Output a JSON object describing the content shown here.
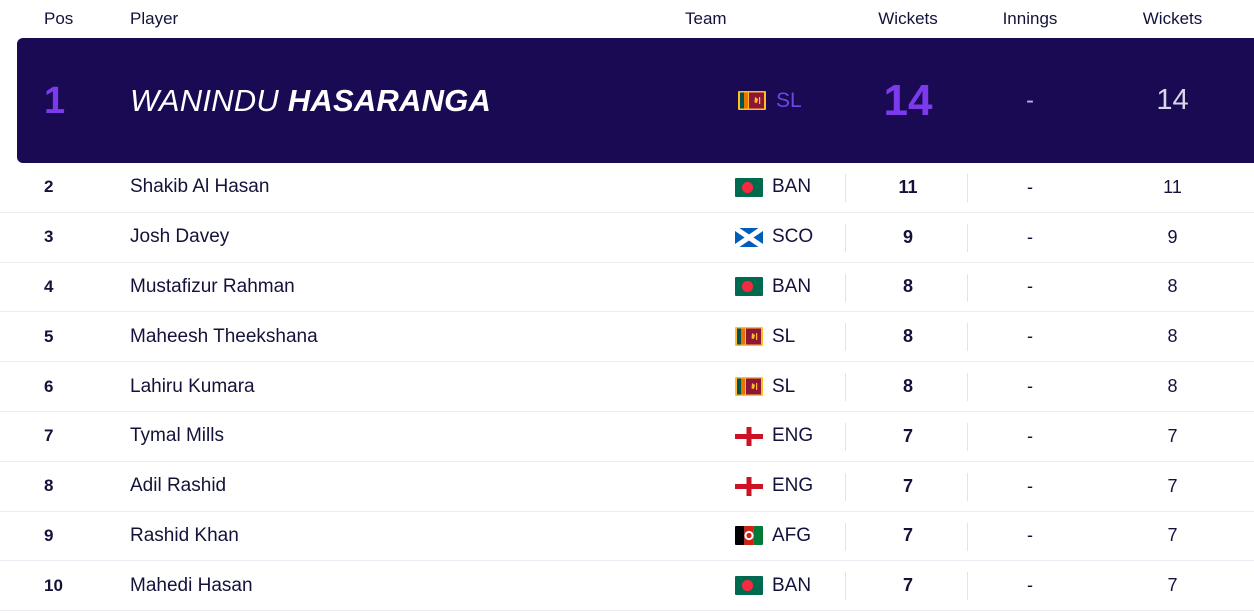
{
  "table": {
    "headers": {
      "pos": "Pos",
      "player": "Player",
      "team": "Team",
      "wickets": "Wickets",
      "innings": "Innings",
      "wickets2": "Wickets"
    },
    "highlighted": {
      "pos": "1",
      "player_first": "WANINDU",
      "player_last": "HASARANGA",
      "team_code": "SL",
      "team_flag": "sri-lanka-flag-icon",
      "wickets": "14",
      "innings": "-",
      "wickets2": "14"
    },
    "rows": [
      {
        "pos": "2",
        "player": "Shakib Al Hasan",
        "team_code": "BAN",
        "team_flag": "bangladesh-flag-icon",
        "wickets": "11",
        "innings": "-",
        "wickets2": "11"
      },
      {
        "pos": "3",
        "player": "Josh Davey",
        "team_code": "SCO",
        "team_flag": "scotland-flag-icon",
        "wickets": "9",
        "innings": "-",
        "wickets2": "9"
      },
      {
        "pos": "4",
        "player": "Mustafizur Rahman",
        "team_code": "BAN",
        "team_flag": "bangladesh-flag-icon",
        "wickets": "8",
        "innings": "-",
        "wickets2": "8"
      },
      {
        "pos": "5",
        "player": "Maheesh Theekshana",
        "team_code": "SL",
        "team_flag": "sri-lanka-flag-icon",
        "wickets": "8",
        "innings": "-",
        "wickets2": "8"
      },
      {
        "pos": "6",
        "player": "Lahiru Kumara",
        "team_code": "SL",
        "team_flag": "sri-lanka-flag-icon",
        "wickets": "8",
        "innings": "-",
        "wickets2": "8"
      },
      {
        "pos": "7",
        "player": "Tymal Mills",
        "team_code": "ENG",
        "team_flag": "england-flag-icon",
        "wickets": "7",
        "innings": "-",
        "wickets2": "7"
      },
      {
        "pos": "8",
        "player": "Adil Rashid",
        "team_code": "ENG",
        "team_flag": "england-flag-icon",
        "wickets": "7",
        "innings": "-",
        "wickets2": "7"
      },
      {
        "pos": "9",
        "player": "Rashid Khan",
        "team_code": "AFG",
        "team_flag": "afghanistan-flag-icon",
        "wickets": "7",
        "innings": "-",
        "wickets2": "7"
      },
      {
        "pos": "10",
        "player": "Mahedi Hasan",
        "team_code": "BAN",
        "team_flag": "bangladesh-flag-icon",
        "wickets": "7",
        "innings": "-",
        "wickets2": "7"
      }
    ]
  },
  "colors": {
    "highlight_background": "#1a0a54",
    "accent_purple": "#7c3aed",
    "text_dark": "#13123a",
    "row_divider": "#eceaf2"
  }
}
